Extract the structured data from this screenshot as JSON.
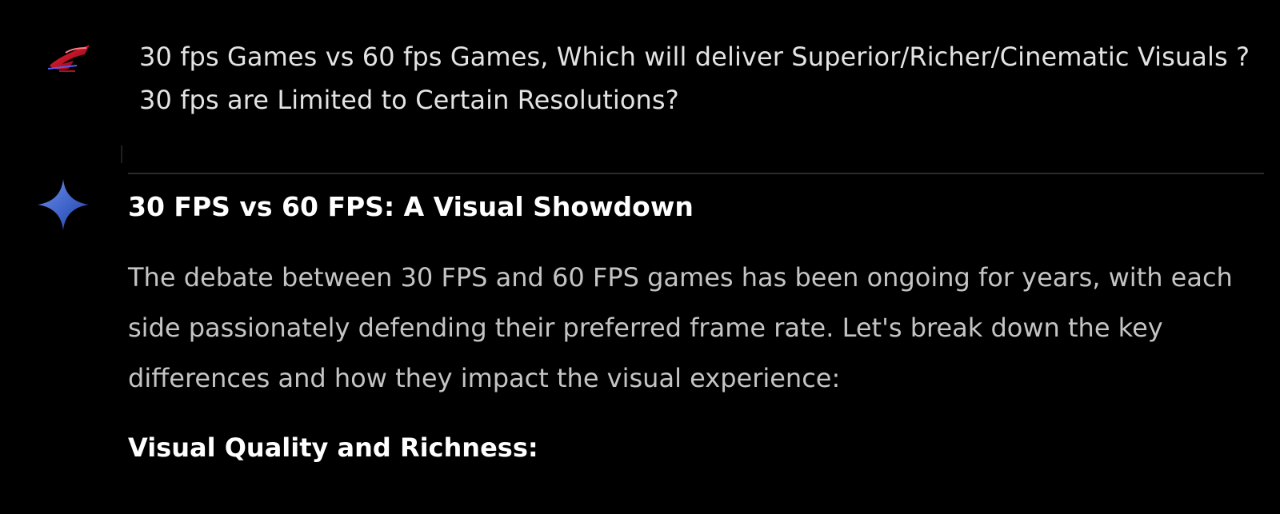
{
  "user_prompt": {
    "line1": "30 fps Games vs 60 fps Games, Which will deliver Superior/Richer/Cinematic Visuals ?",
    "line2": "30 fps are Limited to Certain Resolutions?",
    "avatar_icon": "rog-logo-icon"
  },
  "response": {
    "model_icon": "gemini-sparkle-icon",
    "title": "30 FPS vs 60 FPS: A Visual Showdown",
    "paragraph": "The debate between 30 FPS and 60 FPS games has been ongoing for years, with each side passionately defending their preferred frame rate. Let's break down the key differences and how they impact the visual experience:",
    "subheading": "Visual Quality and Richness:"
  },
  "colors": {
    "background": "#000000",
    "prompt_text": "#e3e3e3",
    "body_text": "#c4c4c4",
    "heading_text": "#ffffff",
    "sparkle_top": "#5b7bd8",
    "sparkle_bottom": "#2a4aa8",
    "avatar_red": "#d0112b"
  }
}
